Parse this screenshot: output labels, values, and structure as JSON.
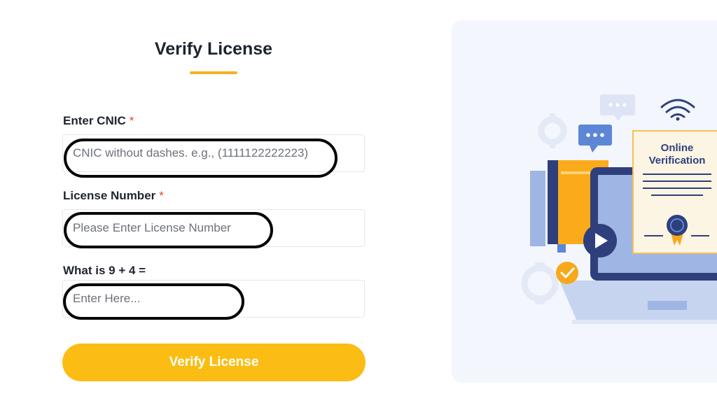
{
  "form": {
    "title": "Verify License",
    "cnic": {
      "label": "Enter CNIC",
      "required_mark": "*",
      "placeholder": "CNIC without dashes. e.g., (1111122222223)",
      "value": ""
    },
    "license": {
      "label": "License Number",
      "required_mark": "*",
      "placeholder": "Please Enter License Number",
      "value": ""
    },
    "captcha": {
      "label": "What is 9 + 4 =",
      "placeholder": "Enter Here...",
      "value": ""
    },
    "submit_label": "Verify License"
  },
  "illustration": {
    "certificate_title_line1": "Online",
    "certificate_title_line2": "Verification"
  },
  "colors": {
    "accent": "#fbbd13",
    "required": "#e0443a",
    "panel_bg": "#f3f6fc",
    "illustration_blue": "#2e3f7c"
  }
}
